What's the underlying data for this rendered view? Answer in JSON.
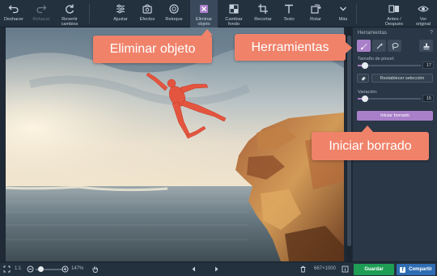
{
  "toolbar": {
    "tools": [
      {
        "key": "undo",
        "label": "Deshacer",
        "icon": "undo-icon"
      },
      {
        "key": "redo",
        "label": "Rehacer",
        "icon": "redo-icon"
      },
      {
        "key": "revert",
        "label": "Revertir\ncambios",
        "icon": "revert-icon"
      },
      {
        "key": "adjust",
        "label": "Ajustar",
        "icon": "adjust-sliders-icon"
      },
      {
        "key": "effects",
        "label": "Efectos",
        "icon": "effects-icon"
      },
      {
        "key": "retouch",
        "label": "Retoque",
        "icon": "retouch-icon"
      },
      {
        "key": "remove_object",
        "label": "Eliminar\nobjeto",
        "icon": "remove-object-icon"
      },
      {
        "key": "change_bg",
        "label": "Cambiar\nfondo",
        "icon": "change-background-icon"
      },
      {
        "key": "crop",
        "label": "Recortar",
        "icon": "crop-icon"
      },
      {
        "key": "text",
        "label": "Texto",
        "icon": "text-icon"
      },
      {
        "key": "rotate",
        "label": "Rotar",
        "icon": "rotate-icon"
      },
      {
        "key": "more",
        "label": "Más",
        "icon": "chevron-down-icon"
      },
      {
        "key": "before_after",
        "label": "Antes /\nDespués",
        "icon": "before-after-icon"
      },
      {
        "key": "original",
        "label": "Ver\noriginal",
        "icon": "eye-icon"
      }
    ]
  },
  "panel": {
    "title": "Herramientas",
    "help": "?",
    "brush_size_label": "Tamaño de pincel:",
    "brush_size_value": "17",
    "brush_size_fraction": 0.12,
    "reset_selection_label": "Restablecer selección",
    "variation_label": "Variación:",
    "variation_value": "15",
    "variation_fraction": 0.12,
    "start_erase_label": "Iniciar borrado"
  },
  "callouts": {
    "remove_object": "Eliminar objeto",
    "tools": "Herramientas",
    "start_erase": "Iniciar borrado"
  },
  "bottom": {
    "fit_label": "1:1",
    "zoom_value": "147%",
    "zoom_fraction": 0.18,
    "dimensions": "667×1000",
    "save_label": "Guardar",
    "share_label": "Compartir"
  },
  "colors": {
    "accent": "#a97fc9",
    "callout": "#f0826a",
    "save": "#1e9e55",
    "share": "#2f6db3"
  }
}
